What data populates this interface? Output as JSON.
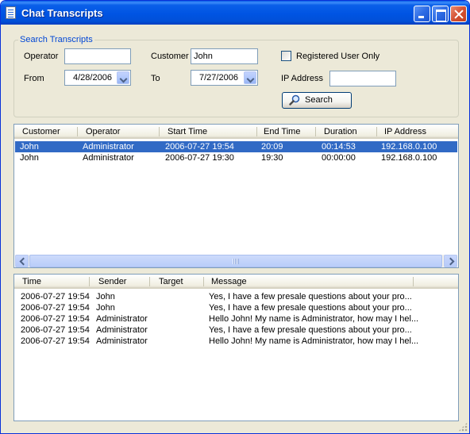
{
  "window": {
    "title": "Chat Transcripts"
  },
  "search": {
    "group_label": "Search Transcripts",
    "operator_label": "Operator",
    "operator_value": "",
    "customer_label": "Customer",
    "customer_value": "John",
    "registered_label": "Registered User Only",
    "registered_checked": false,
    "from_label": "From",
    "from_value": "4/28/2006",
    "to_label": "To",
    "to_value": "7/27/2006",
    "ip_label": "IP Address",
    "ip_value": "",
    "search_button": "Search"
  },
  "sessions": {
    "columns": [
      "Customer",
      "Operator",
      "Start Time",
      "End Time",
      "Duration",
      "IP Address"
    ],
    "rows": [
      {
        "customer": "John",
        "operator": "Administrator",
        "start": "2006-07-27 19:54",
        "end": "20:09",
        "duration": "00:14:53",
        "ip": "192.168.0.100",
        "selected": true
      },
      {
        "customer": "John",
        "operator": "Administrator",
        "start": "2006-07-27 19:30",
        "end": "19:30",
        "duration": "00:00:00",
        "ip": "192.168.0.100",
        "selected": false
      }
    ]
  },
  "messages": {
    "columns": [
      "Time",
      "Sender",
      "Target",
      "Message"
    ],
    "rows": [
      {
        "time": "2006-07-27 19:54",
        "sender": "John",
        "target": "",
        "message": "Yes, I have a few presale questions about your pro..."
      },
      {
        "time": "2006-07-27 19:54",
        "sender": "John",
        "target": "",
        "message": "Yes, I have a few presale questions about your pro..."
      },
      {
        "time": "2006-07-27 19:54",
        "sender": "Administrator",
        "target": "",
        "message": "Hello John! My name is Administrator, how may I hel..."
      },
      {
        "time": "2006-07-27 19:54",
        "sender": "Administrator",
        "target": "",
        "message": "Yes, I have a few presale questions about your pro..."
      },
      {
        "time": "2006-07-27 19:54",
        "sender": "Administrator",
        "target": "",
        "message": "Hello John! My name is Administrator, how may I hel..."
      }
    ]
  },
  "colors": {
    "titlebar": "#0054E3",
    "selection": "#316AC5",
    "window_bg": "#ECE9D8",
    "group_label": "#0046D5"
  },
  "icons": {
    "title": "document-list-icon",
    "search": "magnifier-icon",
    "minimize": "minimize-icon",
    "maximize": "maximize-icon",
    "close": "close-icon"
  }
}
